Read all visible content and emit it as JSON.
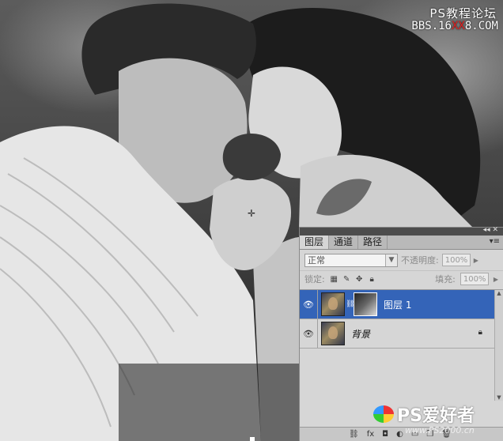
{
  "watermark": {
    "title": "PS教程论坛",
    "url_prefix": "BBS.16",
    "url_red": "XX",
    "url_suffix": "8.COM"
  },
  "layers_panel": {
    "tabs": [
      {
        "label": "图层",
        "active": true
      },
      {
        "label": "通道",
        "active": false
      },
      {
        "label": "路径",
        "active": false
      }
    ],
    "blend_mode": "正常",
    "opacity_label": "不透明度:",
    "opacity_value": "100%",
    "lock_label": "锁定:",
    "fill_label": "填充:",
    "fill_value": "100%",
    "layers": [
      {
        "name": "图层 1",
        "selected": true,
        "has_mask": true
      },
      {
        "name": "背景",
        "selected": false,
        "locked": true
      }
    ]
  },
  "logo": {
    "main": "PS爱好者",
    "sub": "www.PS2000.cn"
  },
  "colors": {
    "selected_layer": "#3464b8",
    "watermark_red": "#e02020"
  }
}
